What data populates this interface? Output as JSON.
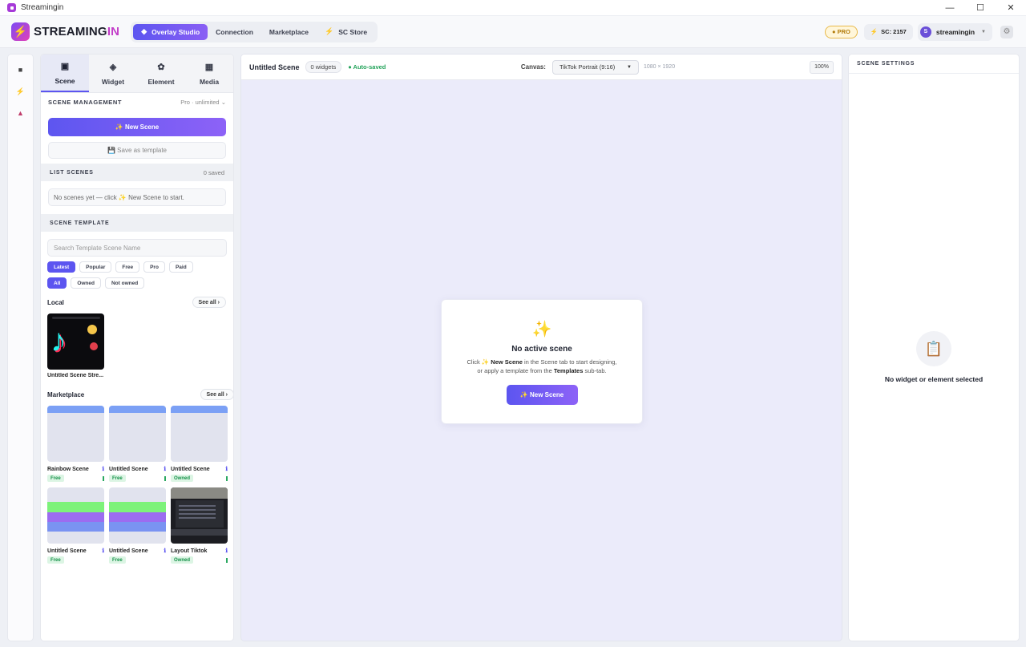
{
  "window": {
    "title": "Streamingin",
    "minimize": "—",
    "maximize": "☐",
    "close": "✕"
  },
  "topbar": {
    "logo_main": "STREAMING",
    "logo_accent": "IN",
    "nav": [
      {
        "label": "Overlay Studio",
        "icon": "◆",
        "active": true
      },
      {
        "label": "Connection"
      },
      {
        "label": "Marketplace"
      },
      {
        "label": "SC Store",
        "icon": "⚡"
      }
    ],
    "pro_badge": "● PRO",
    "sc_balance": "SC: 2157",
    "username": "streamingin",
    "avatar_letter": "S"
  },
  "rail": {
    "icons": [
      "camera-icon",
      "bolt-icon",
      "user-upload-icon"
    ]
  },
  "left": {
    "tabs": [
      {
        "label": "Scene",
        "icon": "▣",
        "active": true
      },
      {
        "label": "Widget",
        "icon": "◈"
      },
      {
        "label": "Element",
        "icon": "✿"
      },
      {
        "label": "Media",
        "icon": "▦"
      }
    ],
    "scene_management": {
      "title": "SCENE MANAGEMENT",
      "plan": "Pro · unlimited",
      "plan_caret": "⌄"
    },
    "new_scene": "✨ New Scene",
    "save_template": "💾 Save as template",
    "list_scenes": {
      "title": "LIST SCENES",
      "count": "0 saved",
      "empty": "No scenes yet — click ✨ New Scene to start."
    },
    "scene_template": {
      "title": "SCENE TEMPLATE",
      "search_placeholder": "Search Template Scene Name",
      "sort_chips": [
        "Latest",
        "Popular",
        "Free",
        "Pro",
        "Paid"
      ],
      "owner_chips": [
        "All",
        "Owned",
        "Not owned"
      ]
    },
    "local": {
      "title": "Local",
      "see_all": "See all ›",
      "items": [
        {
          "name": "Untitled Scene Stre..."
        }
      ]
    },
    "marketplace": {
      "title": "Marketplace",
      "see_all": "See all ›",
      "items": [
        {
          "name": "Rainbow Scene",
          "tag": "Free"
        },
        {
          "name": "Untitled Scene",
          "tag": "Free"
        },
        {
          "name": "Untitled Scene",
          "tag": "Owned"
        },
        {
          "name": "Untitled Scene",
          "tag": "Free"
        },
        {
          "name": "Untitled Scene",
          "tag": "Free"
        },
        {
          "name": "Layout Tiktok",
          "tag": "Owned"
        }
      ]
    }
  },
  "canvas": {
    "scene_name": "Untitled Scene",
    "widgets": "0 widgets",
    "autosaved": "● Auto-saved",
    "canvas_label": "Canvas:",
    "canvas_select": "TikTok Portrait (9:16)",
    "dimensions": "1080 × 1920",
    "zoom": "100%",
    "empty": {
      "icon": "✨",
      "title": "No active scene",
      "line1_pre": "Click ✨ ",
      "line1_bold": "New Scene",
      "line1_post": " in the Scene tab to start designing,",
      "line2_pre": "or apply a template from the ",
      "line2_bold": "Templates",
      "line2_post": " sub-tab.",
      "button": "✨ New Scene"
    }
  },
  "right": {
    "title": "SCENE SETTINGS",
    "icon": "📋",
    "empty_message": "No widget or element selected"
  },
  "colors": {
    "accent": "#5c55f0",
    "accent2": "#8d62f7",
    "success": "#23a35a",
    "canvas_bg": "#ebebfa"
  }
}
